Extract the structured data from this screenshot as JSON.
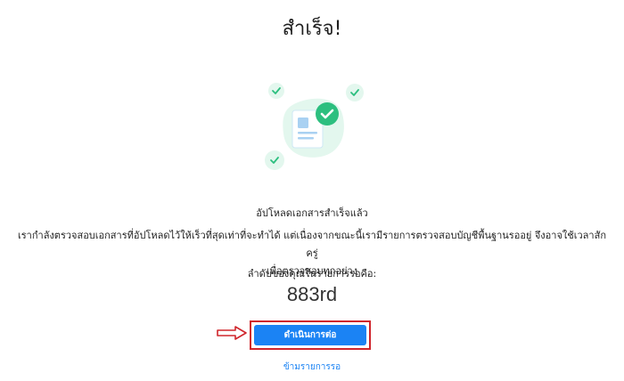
{
  "page": {
    "title": "สำเร็จ!",
    "upload_heading": "อัปโหลดเอกสารสำเร็จแล้ว",
    "description_line1": "เรากำลังตรวจสอบเอกสารที่อัปโหลดไว้ให้เร็วที่สุดเท่าที่จะทำได้ แต่เนื่องจากขณะนี้เรามีรายการตรวจสอบบัญชีพื้นฐานรออยู่ จึงอาจใช้เวลาสักครู่",
    "description_line2": "เพื่อตรวจสอบทุกอย่าง",
    "queue_label": "ลำดับของคุณในรายการรอคือ:",
    "queue_position": "883rd",
    "continue_button": "ดำเนินการต่อ",
    "skip_link": "ข้ามรายการรอ"
  },
  "icons": {
    "illustration": "document-check-illustration",
    "arrow": "right-arrow-icon"
  },
  "colors": {
    "accent": "#1b83f4",
    "highlight_border": "#d0262c",
    "check_green": "#2cbf7f",
    "mint_background": "#e3f7ee"
  }
}
